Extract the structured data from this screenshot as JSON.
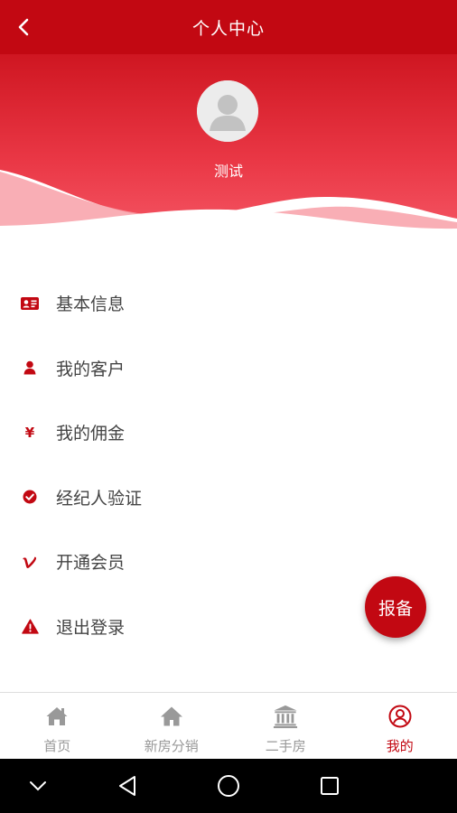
{
  "header": {
    "title": "个人中心"
  },
  "profile": {
    "name": "测试"
  },
  "menu": {
    "items": [
      {
        "label": "基本信息"
      },
      {
        "label": "我的客户"
      },
      {
        "label": "我的佣金"
      },
      {
        "label": "经纪人验证"
      },
      {
        "label": "开通会员"
      },
      {
        "label": "退出登录"
      }
    ],
    "yen_symbol": "¥"
  },
  "fab": {
    "label": "报备"
  },
  "tabs": [
    {
      "label": "首页",
      "icon": "home-icon"
    },
    {
      "label": "新房分销",
      "icon": "house-icon"
    },
    {
      "label": "二手房",
      "icon": "bank-icon"
    },
    {
      "label": "我的",
      "icon": "user-circle-icon",
      "active": true
    }
  ],
  "colors": {
    "brand": "#c20812",
    "tab_inactive": "#999999"
  }
}
